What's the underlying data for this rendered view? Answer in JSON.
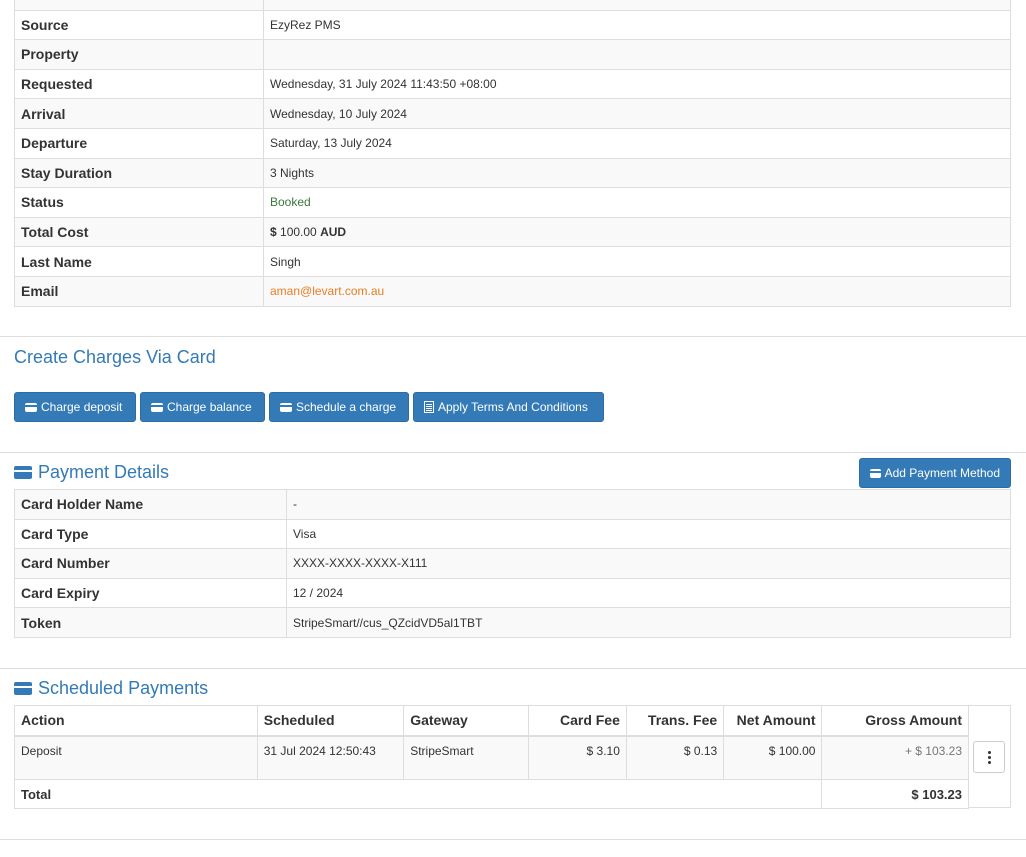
{
  "booking_details": {
    "rows": [
      {
        "label": "",
        "value": ""
      },
      {
        "label": "Source",
        "value": "EzyRez PMS"
      },
      {
        "label": "Property",
        "value": ""
      },
      {
        "label": "Requested",
        "value": "Wednesday, 31 July 2024 11:43:50 +08:00"
      },
      {
        "label": "Arrival",
        "value": "Wednesday, 10 July 2024"
      },
      {
        "label": "Departure",
        "value": "Saturday, 13 July 2024"
      },
      {
        "label": "Stay Duration",
        "value": "3 Nights"
      },
      {
        "label": "Status",
        "value": "Booked"
      },
      {
        "label": "Total Cost",
        "currency_symbol": "$",
        "amount": "100.00",
        "currency": "AUD"
      },
      {
        "label": "Last Name",
        "value": "Singh"
      },
      {
        "label": "Email",
        "value": "aman@levart.com.au"
      }
    ]
  },
  "create_charges": {
    "title": "Create Charges Via Card",
    "buttons": {
      "charge_deposit": "Charge deposit",
      "charge_balance": "Charge balance",
      "schedule_charge": "Schedule a charge",
      "apply_terms": "Apply Terms And Conditions"
    }
  },
  "payment_details": {
    "title": "Payment Details",
    "add_method_label": "Add Payment Method",
    "rows": [
      {
        "label": "Card Holder Name",
        "value": "-"
      },
      {
        "label": "Card Type",
        "value": "Visa"
      },
      {
        "label": "Card Number",
        "value": "XXXX-XXXX-XXXX-X111"
      },
      {
        "label": "Card Expiry",
        "value": "12 / 2024"
      },
      {
        "label": "Token",
        "value": "StripeSmart//cus_QZcidVD5al1TBT"
      }
    ]
  },
  "scheduled_payments": {
    "title": "Scheduled Payments",
    "headers": [
      "Action",
      "Scheduled",
      "Gateway",
      "Card Fee",
      "Trans. Fee",
      "Net Amount",
      "Gross Amount"
    ],
    "rows": [
      {
        "action": "Deposit",
        "scheduled": "31 Jul 2024 12:50:43",
        "gateway": "StripeSmart",
        "card_fee": "$ 3.10",
        "trans_fee": "$ 0.13",
        "net_amount": "$ 100.00",
        "gross_amount": "+ $ 103.23"
      }
    ],
    "total_label": "Total",
    "total_value": "$ 103.23"
  },
  "colors": {
    "primary": "#337ab7",
    "status_booked": "#3c763d",
    "email_link": "#e67e22"
  }
}
